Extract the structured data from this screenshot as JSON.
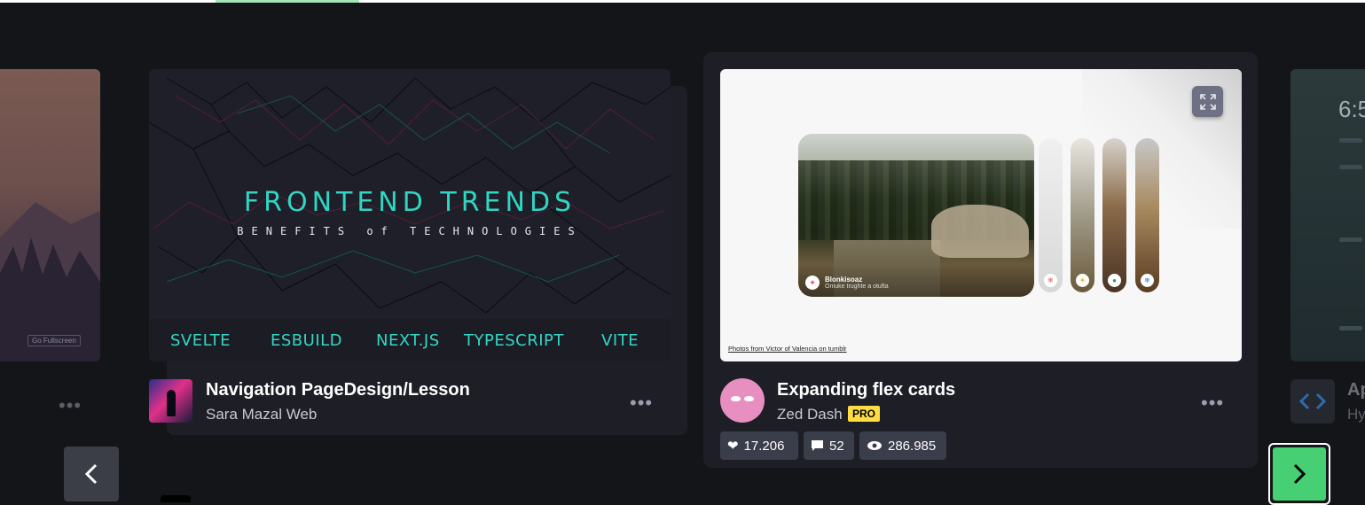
{
  "left_card": {
    "fullscreen_label": "Go Fullscreen",
    "more_label": "•••"
  },
  "card1": {
    "title": "Navigation PageDesign/Lesson",
    "author": "Sara Mazal Web",
    "preview": {
      "heading": "FRONTEND TRENDS",
      "subheading": "BENEFITS of TECHNOLOGIES",
      "technologies": [
        "SVELTE",
        "ESBUILD",
        "NEXT.JS",
        "TYPESCRIPT",
        "VITE"
      ]
    },
    "more_label": "•••"
  },
  "card2": {
    "title": "Expanding flex cards",
    "author": "Zed Dash",
    "badge": "PRO",
    "preview": {
      "main_card_title": "Blonkisoaz",
      "main_card_subtitle": "Omuke trughte a otufta",
      "credit": "Photos from Victor of Valencia on tumblr"
    },
    "stats": {
      "likes": "17.206",
      "comments": "52",
      "views": "286.985"
    },
    "more_label": "•••"
  },
  "right_card": {
    "time": "6:5",
    "title": "Ap",
    "subtitle": "Hy"
  },
  "colors": {
    "accent_green": "#47cf73",
    "pro_yellow": "#ffdd40",
    "teal_text": "#33d6c5",
    "avatar_pink": "#e78fc0"
  }
}
